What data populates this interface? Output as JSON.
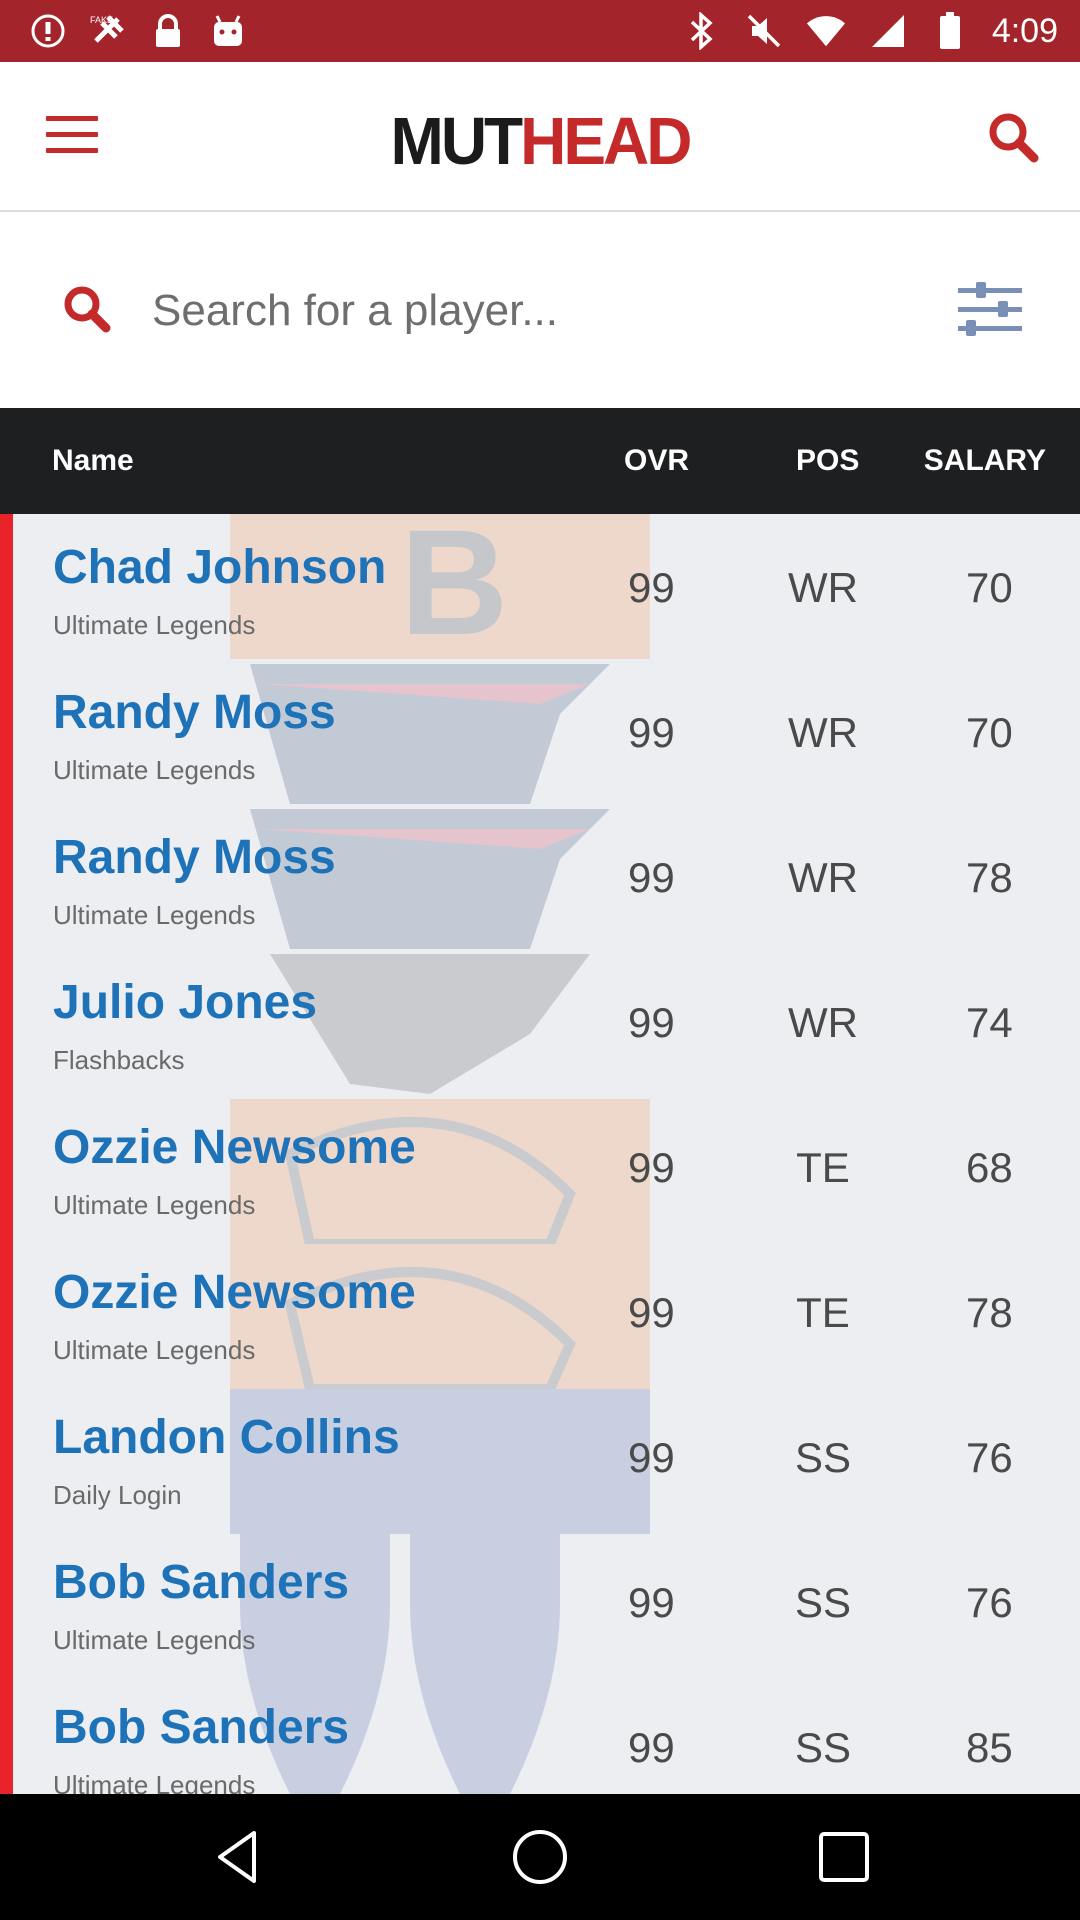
{
  "status_bar": {
    "time": "4:09",
    "left_icons": [
      "alert-icon",
      "fake-gps-icon",
      "lock-icon",
      "android-icon"
    ],
    "right_icons": [
      "bluetooth-icon",
      "mute-icon",
      "wifi-icon",
      "signal-icon",
      "battery-icon"
    ]
  },
  "header": {
    "logo_part1": "MUT",
    "logo_part2": "HEAD"
  },
  "search": {
    "placeholder": "Search for a player..."
  },
  "table": {
    "columns": {
      "name": "Name",
      "ovr": "OVR",
      "pos": "POS",
      "salary": "SALARY"
    },
    "rows": [
      {
        "name": "Chad Johnson",
        "set": "Ultimate Legends",
        "ovr": "99",
        "pos": "WR",
        "salary": "70"
      },
      {
        "name": "Randy Moss",
        "set": "Ultimate Legends",
        "ovr": "99",
        "pos": "WR",
        "salary": "70"
      },
      {
        "name": "Randy Moss",
        "set": "Ultimate Legends",
        "ovr": "99",
        "pos": "WR",
        "salary": "78"
      },
      {
        "name": "Julio Jones",
        "set": "Flashbacks",
        "ovr": "99",
        "pos": "WR",
        "salary": "74"
      },
      {
        "name": "Ozzie Newsome",
        "set": "Ultimate Legends",
        "ovr": "99",
        "pos": "TE",
        "salary": "68"
      },
      {
        "name": "Ozzie Newsome",
        "set": "Ultimate Legends",
        "ovr": "99",
        "pos": "TE",
        "salary": "78"
      },
      {
        "name": "Landon Collins",
        "set": "Daily Login",
        "ovr": "99",
        "pos": "SS",
        "salary": "76"
      },
      {
        "name": "Bob Sanders",
        "set": "Ultimate Legends",
        "ovr": "99",
        "pos": "SS",
        "salary": "76"
      },
      {
        "name": "Bob Sanders",
        "set": "Ultimate Legends",
        "ovr": "99",
        "pos": "SS",
        "salary": "85"
      }
    ]
  },
  "colors": {
    "status_bar": "#a3242b",
    "accent_red": "#c42a2a",
    "player_name_blue": "#1d72b8",
    "table_header": "#1e1f21"
  }
}
